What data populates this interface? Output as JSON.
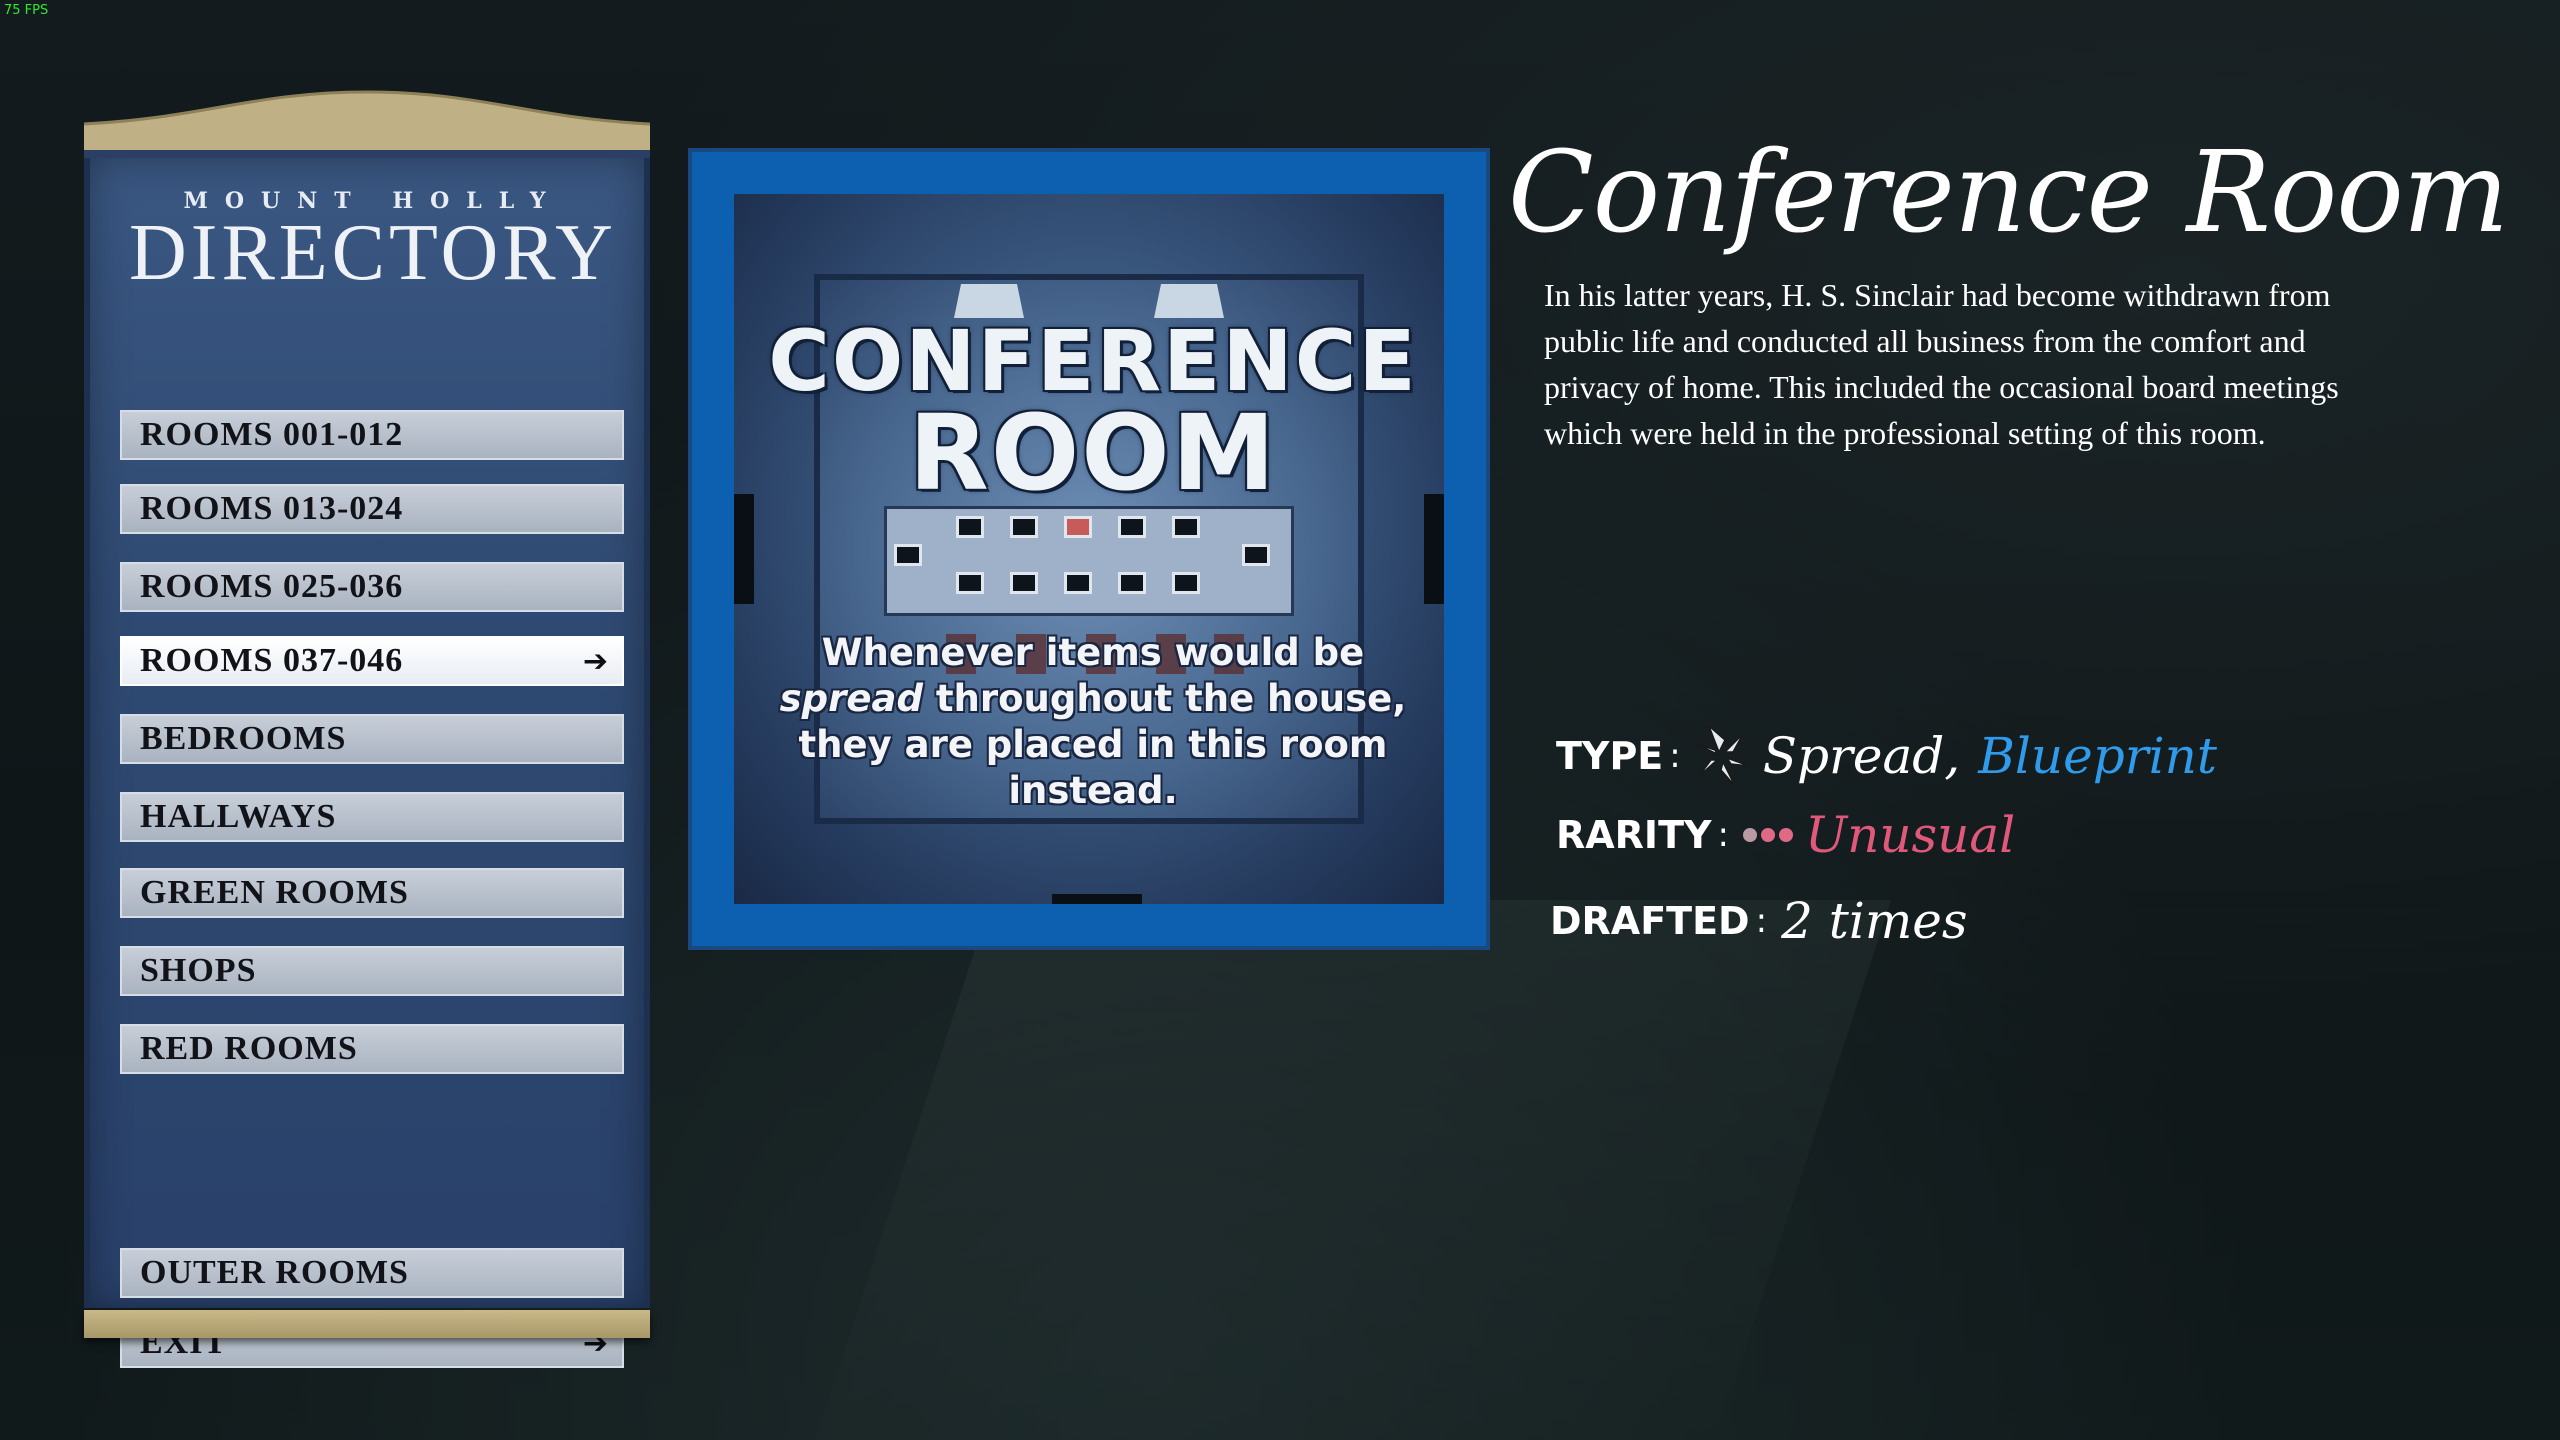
{
  "fps": "75 FPS",
  "directory": {
    "subtitle": "MOUNT HOLLY",
    "title": "DIRECTORY",
    "items": [
      {
        "label": "ROOMS 001-012"
      },
      {
        "label": "ROOMS 013-024"
      },
      {
        "label": "ROOMS 025-036"
      },
      {
        "label": "ROOMS 037-046",
        "selected": true
      },
      {
        "label": "BEDROOMS"
      },
      {
        "label": "HALLWAYS"
      },
      {
        "label": "GREEN ROOMS"
      },
      {
        "label": "SHOPS"
      },
      {
        "label": "RED ROOMS"
      },
      {
        "label": "OUTER ROOMS"
      },
      {
        "label": "EXIT"
      }
    ],
    "arrow_icon": "arrow-right-icon"
  },
  "card": {
    "name_line1": "CONFERENCE",
    "name_line2": "ROOM",
    "effect_pre": "Whenever items would be ",
    "effect_em": "spread",
    "effect_post": " throughout the house, they are placed in this room instead.",
    "frame_color": "#0d5fb0"
  },
  "details": {
    "title": "Conference Room",
    "description": "In his latter years, H. S. Sinclair had become withdrawn from public life and conducted all business from the comfort and privacy of home. This included the occasional board meetings which were held in the professional setting of this room.",
    "type_label": "TYPE",
    "type_icon": "spread-arrows-icon",
    "type_primary": "Spread,",
    "type_secondary": "Blueprint",
    "rarity_label": "RARITY",
    "rarity_dots": 3,
    "rarity_value": "Unusual",
    "drafted_label": "DRAFTED",
    "drafted_value": "2 times",
    "colon": ":",
    "colors": {
      "blueprint": "#2f9bea",
      "unusual": "#e0587a"
    }
  }
}
